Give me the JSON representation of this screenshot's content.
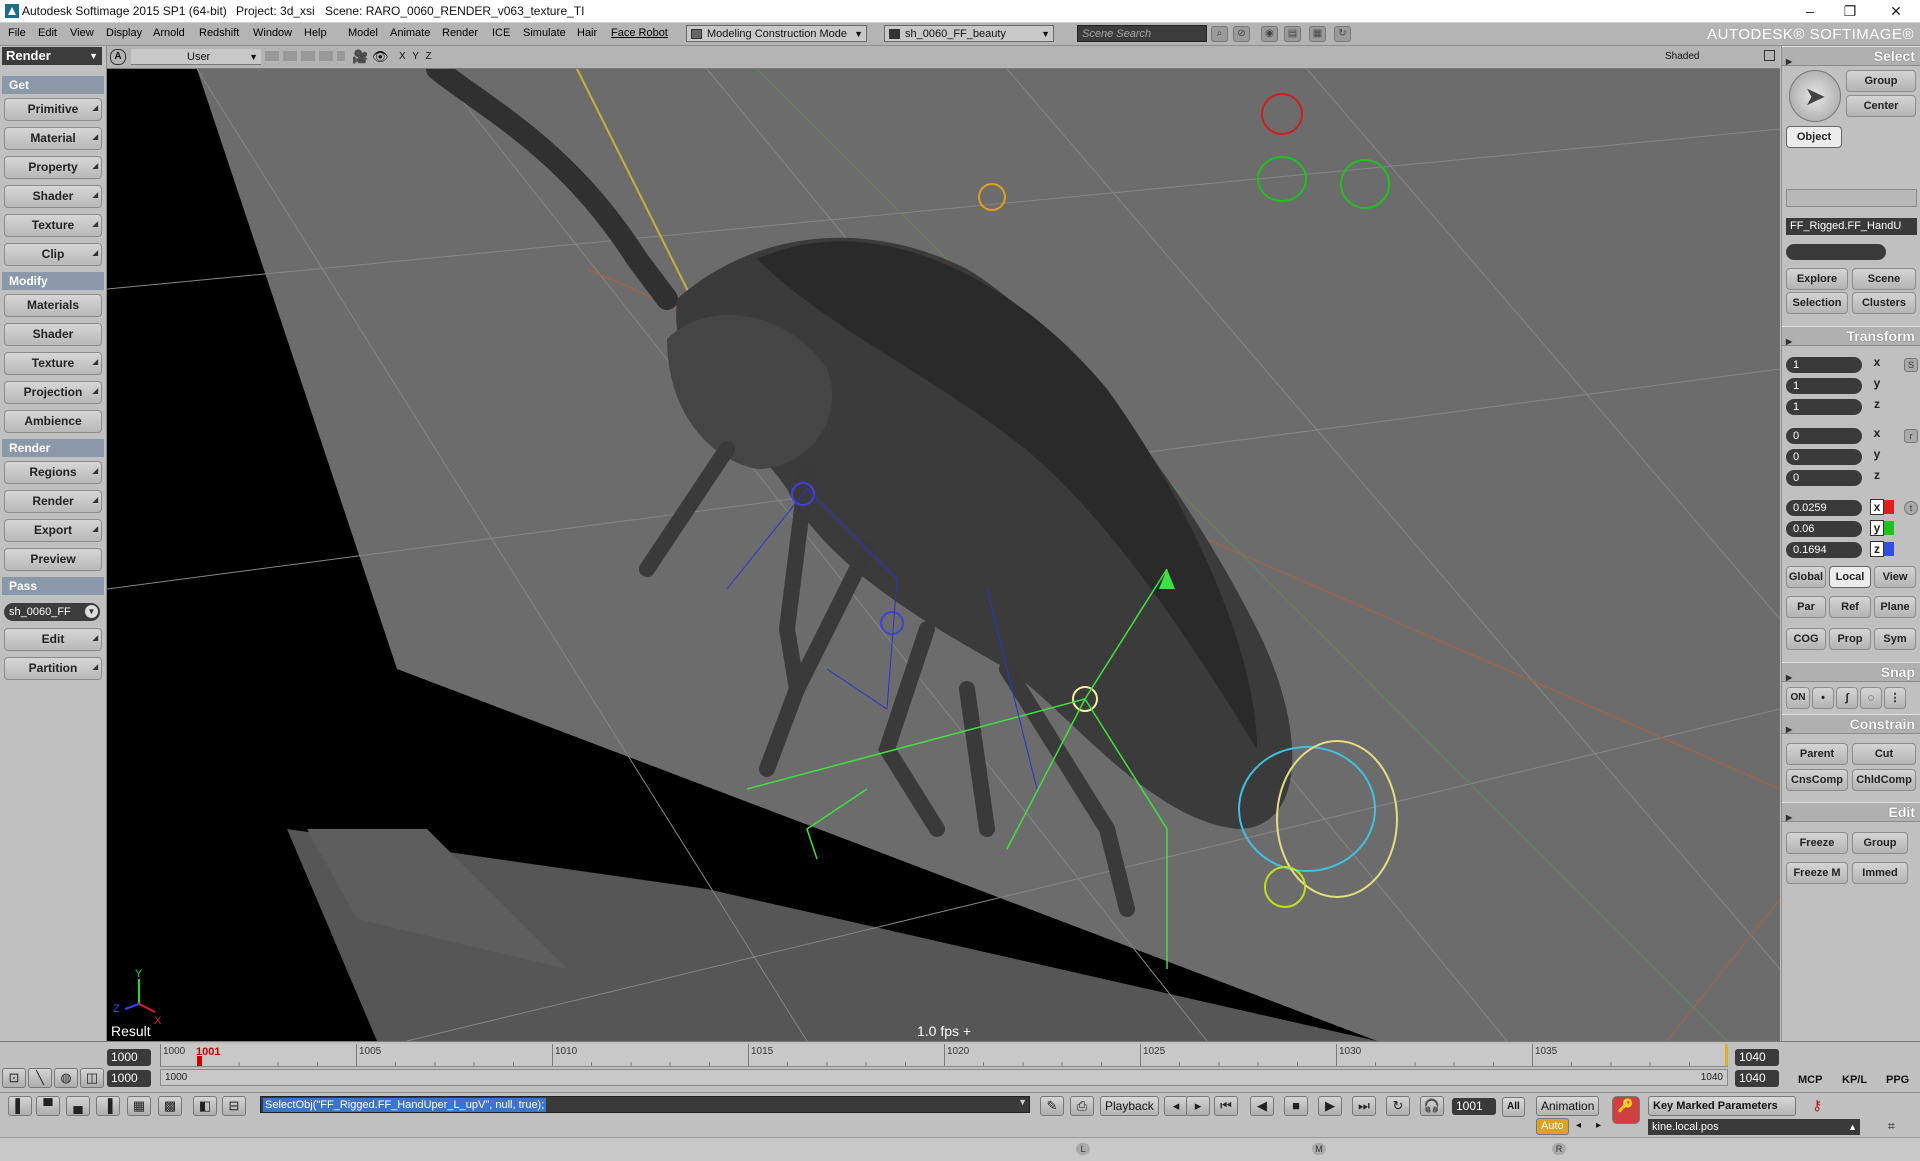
{
  "window": {
    "app_title": "Autodesk Softimage 2015 SP1 (64-bit)",
    "project": "Project: 3d_xsi",
    "scene": "Scene: RARO_0060_RENDER_v063_texture_TI",
    "controls": [
      "–",
      "❐",
      "✕"
    ]
  },
  "menubar": {
    "items": [
      "File",
      "Edit",
      "View",
      "Display",
      "Arnold",
      "Redshift",
      "Window",
      "Help",
      "Model",
      "Animate",
      "Render",
      "ICE",
      "Simulate",
      "Hair",
      "Face Robot"
    ],
    "construction_mode": "Modeling Construction Mode",
    "pass": "sh_0060_FF_beauty",
    "scene_search_placeholder": "Scene Search",
    "brand": "AUTODESK® SOFTIMAGE®"
  },
  "left_panel": {
    "module_menu": "Render",
    "sections": [
      {
        "header": "Get",
        "buttons": [
          "Primitive",
          "Material",
          "Property",
          "Shader",
          "Texture",
          "Clip"
        ]
      },
      {
        "header": "Modify",
        "buttons": [
          "Materials",
          "Shader",
          "Texture",
          "Projection",
          "Ambience"
        ]
      },
      {
        "header": "Render",
        "buttons": [
          "Regions",
          "Render",
          "Export",
          "Preview"
        ]
      },
      {
        "header": "Pass",
        "buttons": [
          "Edit",
          "Partition"
        ]
      }
    ],
    "pass_combo": "sh_0060_FF"
  },
  "viewport": {
    "letter": "A",
    "camera": "User",
    "axis_labels": "X Y Z",
    "shading_mode": "Shaded",
    "result_label": "Result",
    "fps": "1.0   fps  +"
  },
  "right_panel": {
    "select": {
      "title": "Select",
      "buttons": [
        "Group",
        "Center",
        "Object"
      ],
      "object_name": "FF_Rigged.FF_HandU",
      "explore_buttons": [
        "Explore",
        "Scene",
        "Selection",
        "Clusters"
      ]
    },
    "transform": {
      "title": "Transform",
      "scale": [
        "1",
        "1",
        "1"
      ],
      "rotation": [
        "0",
        "0",
        "0"
      ],
      "translation": [
        "0.0259",
        "0.06",
        "0.1694"
      ],
      "axes": [
        "x",
        "y",
        "z"
      ],
      "space_buttons": [
        "Global",
        "Local",
        "View"
      ],
      "ref_buttons": [
        "Par",
        "Ref",
        "Plane"
      ],
      "option_buttons": [
        "COG",
        "Prop",
        "Sym"
      ]
    },
    "snap": {
      "title": "Snap",
      "on_label": "ON"
    },
    "constrain": {
      "title": "Constrain",
      "buttons": [
        "Parent",
        "Cut",
        "CnsComp",
        "ChldComp"
      ]
    },
    "edit": {
      "title": "Edit",
      "buttons": [
        "Freeze",
        "Group",
        "Freeze M",
        "Immed"
      ]
    },
    "tabs": [
      "MCP",
      "KP/L",
      "PPG"
    ]
  },
  "timeline": {
    "start": "1000",
    "range_start": "1000",
    "range_start_label": "1000",
    "current_frame": "1001",
    "ruler_labels": [
      "1000",
      "1005",
      "1010",
      "1015",
      "1020",
      "1025",
      "1030",
      "1035"
    ],
    "end": "1040",
    "range_end": "1040",
    "range_end_label": "1040"
  },
  "bottom_bar": {
    "command": "SelectObj(\"FF_Rigged.FF_HandUper_L_upV\", null, true);",
    "playback_label": "Playback",
    "frame_field": "1001",
    "all_label": "All",
    "animation_label": "Animation",
    "auto_label": "Auto",
    "key_marked": "Key Marked Parameters",
    "kine_field": "kine.local.pos"
  },
  "status_bar": {
    "mouse_buttons": [
      "L",
      "M",
      "R"
    ]
  },
  "colors": {
    "header_blue": "#8a98aa",
    "field_dark": "#3a3a3a",
    "selection_blue": "#3a74cf",
    "current_frame_red": "#cc0000",
    "viewport_gray": "#6e6e6e"
  }
}
